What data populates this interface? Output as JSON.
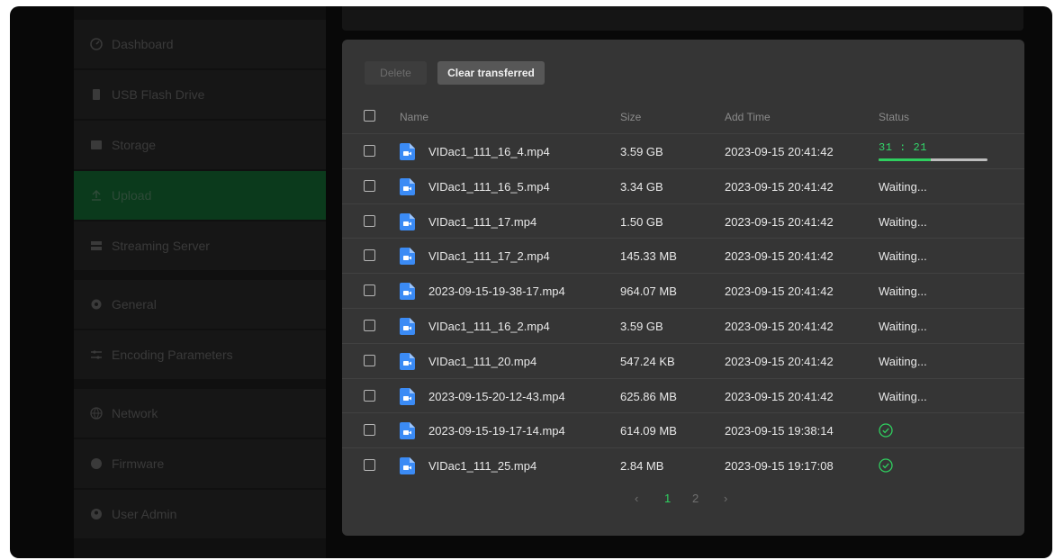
{
  "sidebar": {
    "items": [
      {
        "label": "Dashboard",
        "icon": "gauge-icon",
        "active": false
      },
      {
        "label": "USB Flash Drive",
        "icon": "usb-drive-icon",
        "active": false
      },
      {
        "label": "Storage",
        "icon": "storage-icon",
        "active": false
      },
      {
        "label": "Upload",
        "icon": "upload-icon",
        "active": true
      },
      {
        "label": "Streaming Server",
        "icon": "server-icon",
        "active": false
      },
      {
        "label": "General",
        "icon": "gear-icon",
        "active": false
      },
      {
        "label": "Encoding Parameters",
        "icon": "sliders-icon",
        "active": false
      },
      {
        "label": "Network",
        "icon": "globe-icon",
        "active": false
      },
      {
        "label": "Firmware",
        "icon": "info-icon",
        "active": false
      },
      {
        "label": "User Admin",
        "icon": "user-icon",
        "active": false
      }
    ]
  },
  "dialog": {
    "delete_label": "Delete",
    "clear_label": "Clear transferred",
    "columns": {
      "name": "Name",
      "size": "Size",
      "add_time": "Add Time",
      "status": "Status"
    },
    "rows": [
      {
        "name": "VIDac1_111_16_4.mp4",
        "size": "3.59 GB",
        "add_time": "2023-09-15 20:41:42",
        "status": "progress",
        "progress_text": "31 : 21",
        "progress": 0.48
      },
      {
        "name": "VIDac1_111_16_5.mp4",
        "size": "3.34 GB",
        "add_time": "2023-09-15 20:41:42",
        "status": "Waiting..."
      },
      {
        "name": "VIDac1_111_17.mp4",
        "size": "1.50 GB",
        "add_time": "2023-09-15 20:41:42",
        "status": "Waiting..."
      },
      {
        "name": "VIDac1_111_17_2.mp4",
        "size": "145.33 MB",
        "add_time": "2023-09-15 20:41:42",
        "status": "Waiting..."
      },
      {
        "name": "2023-09-15-19-38-17.mp4",
        "size": "964.07 MB",
        "add_time": "2023-09-15 20:41:42",
        "status": "Waiting..."
      },
      {
        "name": "VIDac1_111_16_2.mp4",
        "size": "3.59 GB",
        "add_time": "2023-09-15 20:41:42",
        "status": "Waiting..."
      },
      {
        "name": "VIDac1_111_20.mp4",
        "size": "547.24 KB",
        "add_time": "2023-09-15 20:41:42",
        "status": "Waiting..."
      },
      {
        "name": "2023-09-15-20-12-43.mp4",
        "size": "625.86 MB",
        "add_time": "2023-09-15 20:41:42",
        "status": "Waiting..."
      },
      {
        "name": "2023-09-15-19-17-14.mp4",
        "size": "614.09 MB",
        "add_time": "2023-09-15 19:38:14",
        "status": "done"
      },
      {
        "name": "VIDac1_111_25.mp4",
        "size": "2.84 MB",
        "add_time": "2023-09-15 19:17:08",
        "status": "done"
      }
    ],
    "pagination": {
      "prev_icon": "chevron-left-icon",
      "next_icon": "chevron-right-icon",
      "pages": [
        "1",
        "2"
      ],
      "current": "1"
    }
  },
  "colors": {
    "accent": "#2fcf5f",
    "file_icon": "#3b8bf5",
    "dialog_bg": "#353535"
  }
}
